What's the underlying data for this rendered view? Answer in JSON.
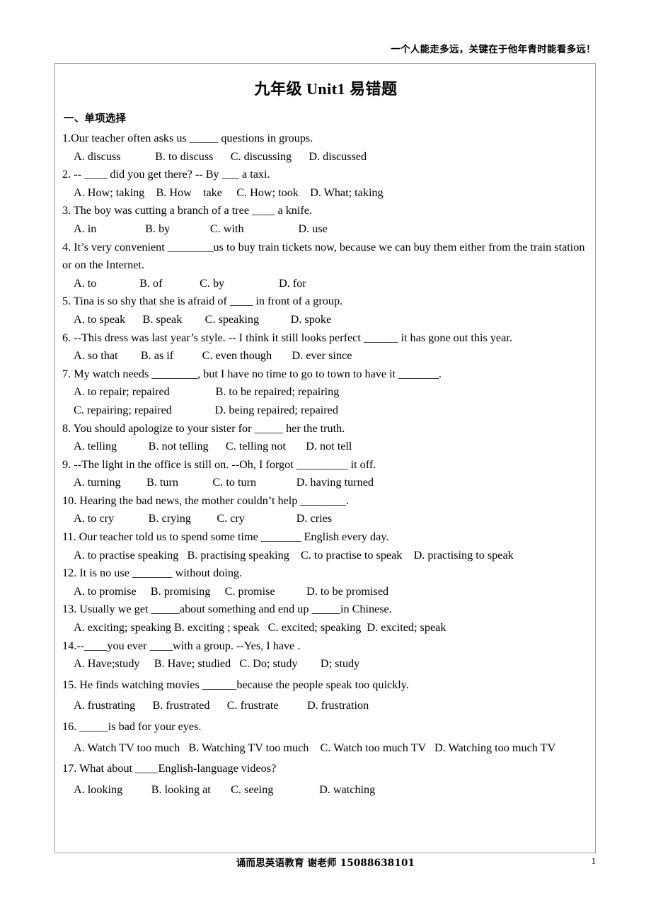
{
  "header": {
    "running_text": "一个人能走多远，关键在于他年青时能看多远！"
  },
  "document": {
    "title": "九年级 Unit1 易错题",
    "section_heading": "一、单项选择"
  },
  "questions": [
    {
      "stem": "1.Our teacher often asks us _____ questions in groups.",
      "options_lines": [
        "A. discuss            B. to discuss      C. discussing      D. discussed"
      ]
    },
    {
      "stem": "2. -- ____ did you get there?   -- By ___ a taxi.",
      "options_lines": [
        "A. How; taking    B. How    take     C. How; took    D. What; taking"
      ]
    },
    {
      "stem": "3. The boy was cutting a branch of a tree ____ a knife.",
      "options_lines": [
        "A. in                 B. by              C. with                   D. use"
      ]
    },
    {
      "stem": "4. It’s very convenient ________us to buy train tickets now, because we can buy them either from the train station or on the Internet.",
      "options_lines": [
        "A. to               B. of             C. by                   D. for"
      ]
    },
    {
      "stem": "5. Tina is so shy that she is afraid of ____ in front of a group.",
      "options_lines": [
        "A. to speak      B. speak        C. speaking           D. spoke"
      ]
    },
    {
      "stem": "6. --This dress was last year’s style.  -- I think it still looks perfect ______ it has gone out this year.",
      "options_lines": [
        "A. so that        B. as if          C. even though       D. ever since"
      ]
    },
    {
      "stem": "7. My watch needs ________, but I have no time to go to town to have it _______.",
      "options_lines": [
        "A. to repair; repaired                B. to be repaired; repairing",
        "C. repairing; repaired               D. being repaired; repaired"
      ]
    },
    {
      "stem": "8. You should apologize to your sister for _____ her the truth.",
      "options_lines": [
        "A. telling           B. not telling      C. telling not       D. not tell"
      ]
    },
    {
      "stem": "9. --The light in the office is still on.   --Oh, I forgot _________ it off.",
      "options_lines": [
        "A. turning         B. turn            C. to turn              D. having turned"
      ]
    },
    {
      "stem": "10. Hearing the bad news, the mother couldn’t help ________.",
      "options_lines": [
        "A. to cry            B. crying         C. cry                  D. cries"
      ]
    },
    {
      "stem": "11. Our teacher told us to spend some time _______ English every day.",
      "options_lines": [
        "A. to practise speaking   B. practising speaking    C. to practise to speak    D. practising to speak"
      ]
    },
    {
      "stem": "12. It is no use _______ without doing.",
      "options_lines": [
        "A. to promise     B. promising     C. promise           D. to be promised"
      ]
    },
    {
      "stem": "13. Usually we get _____about something and end up _____in Chinese.",
      "options_lines": [
        "A. exciting; speaking B. exciting ; speak   C. excited; speaking  D. excited; speak"
      ]
    },
    {
      "stem": "14.--____you ever ____with a group.   --Yes, I have .",
      "options_lines": [
        "A. Have;study     B. Have; studied   C. Do; study        D; study"
      ]
    },
    {
      "stem": "15. He finds watching movies ______because the people speak too quickly.",
      "options_lines": [
        "A. frustrating      B. frustrated      C. frustrate          D. frustration"
      ]
    },
    {
      "stem": "16. _____is bad for your eyes.",
      "options_lines": [
        "A. Watch TV too much   B. Watching TV too much    C. Watch too much TV   D. Watching too much TV"
      ]
    },
    {
      "stem": "17. What about ____English-language videos?",
      "options_lines": [
        "A. looking          B. looking at       C. seeing                D. watching"
      ]
    }
  ],
  "footer": {
    "center_text": "诵而思英语教育  谢老师 15088638101",
    "page_number": "1"
  }
}
